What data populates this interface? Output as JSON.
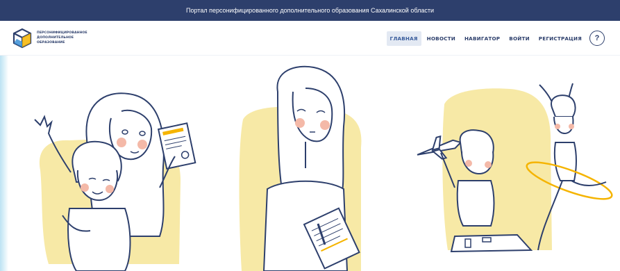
{
  "topbar": {
    "title": "Портал персонифицированного дополнительного образования Сахалинской области"
  },
  "logo": {
    "icon": "cube-logo-icon",
    "line1": "ПЕРСОНИФИЦИРОВАННОЕ",
    "line2": "ДОПОЛНИТЕЛЬНОЕ",
    "line3": "ОБРАЗОВАНИЕ"
  },
  "nav": {
    "items": [
      {
        "label": "ГЛАВНАЯ",
        "active": true
      },
      {
        "label": "НОВОСТИ",
        "active": false
      },
      {
        "label": "НАВИГАТОР",
        "active": false
      },
      {
        "label": "ВОЙТИ",
        "active": false
      },
      {
        "label": "РЕГИСТРАЦИЯ",
        "active": false
      }
    ],
    "help_label": "?"
  },
  "colors": {
    "header_bg": "#2d3f6c",
    "accent_yellow": "#f7e9a6",
    "line_ink": "#2d3f6c",
    "active_tab_bg": "#e3e9f3"
  }
}
